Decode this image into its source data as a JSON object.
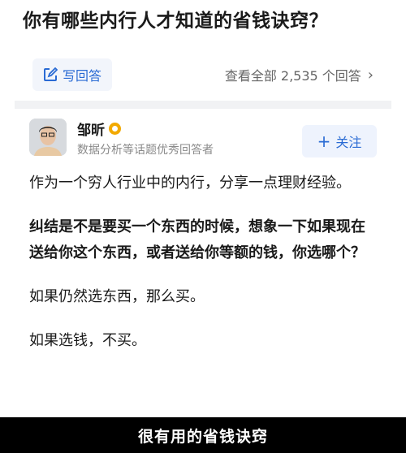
{
  "question": {
    "title": "你有哪些内行人才知道的省钱诀窍？"
  },
  "actions": {
    "write_answer": "写回答",
    "view_all": "查看全部 2,535 个回答"
  },
  "author": {
    "name": "邹昕",
    "description": "数据分析等话题优秀回答者",
    "follow_label": "关注",
    "badge_color": "#f2a900"
  },
  "answer": {
    "p1": "作为一个穷人行业中的内行，分享一点理财经验。",
    "p2": "纠结是不是要买一个东西的时候，想象一下如果现在送给你这个东西，或者送给你等额的钱，你选哪个？",
    "p3": "如果仍然选东西，那么买。",
    "p4": "如果选钱，不买。"
  },
  "caption": "很有用的省钱诀窍",
  "colors": {
    "accent": "#2a6bd4",
    "caption_bg": "#000000"
  },
  "icons": {
    "write": "edit-icon",
    "chevron": "chevron-right-icon",
    "badge": "excellence-badge-icon",
    "follow": "plus-icon"
  }
}
